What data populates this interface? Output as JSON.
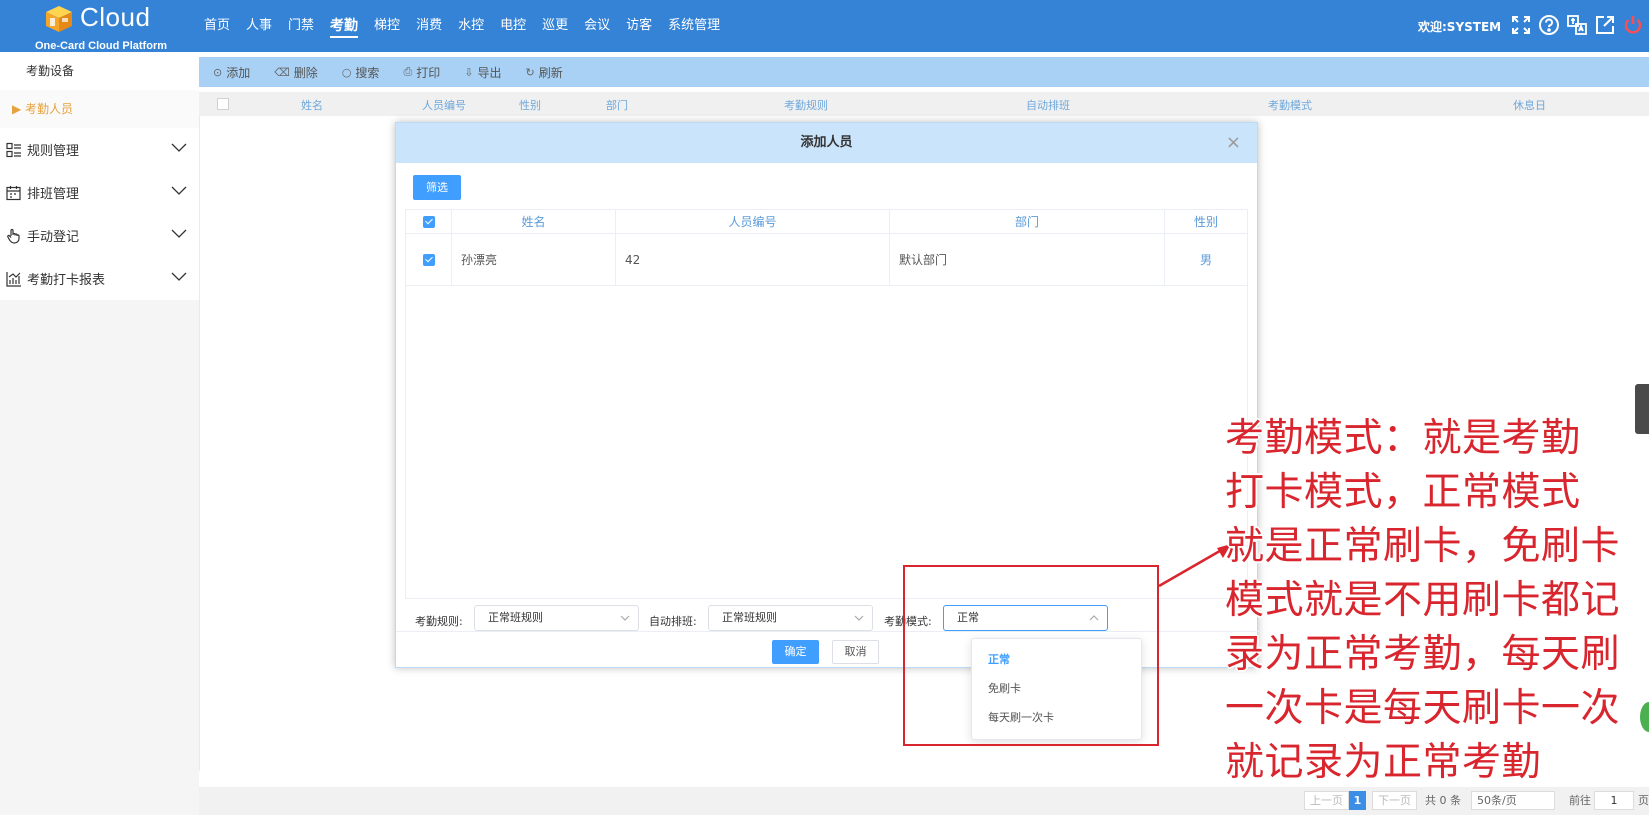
{
  "header": {
    "logo_text": "Cloud",
    "logo_subtitle": "One-Card Cloud Platform",
    "nav": [
      "首页",
      "人事",
      "门禁",
      "考勤",
      "梯控",
      "消费",
      "水控",
      "电控",
      "巡更",
      "会议",
      "访客",
      "系统管理"
    ],
    "active_nav": "考勤",
    "welcome": "欢迎:SYSTEM",
    "icons": [
      "fullscreen-icon",
      "help-icon",
      "translate-icon",
      "external-link-icon",
      "power-icon"
    ]
  },
  "sidebar": {
    "sub_items": [
      {
        "label": "考勤设备"
      },
      {
        "label": "▶ 考勤人员"
      }
    ],
    "groups": [
      {
        "label": "规则管理",
        "icon": "rules-icon"
      },
      {
        "label": "排班管理",
        "icon": "schedule-icon"
      },
      {
        "label": "手动登记",
        "icon": "hand-icon"
      },
      {
        "label": "考勤打卡报表",
        "icon": "report-icon"
      }
    ]
  },
  "toolbar": {
    "buttons": [
      {
        "label": "添加",
        "icon": "⊙"
      },
      {
        "label": "删除",
        "icon": "🗑"
      },
      {
        "label": "搜索",
        "icon": "○"
      },
      {
        "label": "打印",
        "icon": "⎙"
      },
      {
        "label": "导出",
        "icon": "⇩"
      },
      {
        "label": "刷新",
        "icon": "↻"
      }
    ]
  },
  "main_table": {
    "columns": [
      "姓名",
      "人员编号",
      "性别",
      "部门",
      "考勤规则",
      "自动排班",
      "考勤模式",
      "休息日"
    ]
  },
  "pagination": {
    "prev": "上一页",
    "current": "1",
    "next": "下一页",
    "total": "共 0 条",
    "page_size": "50条/页",
    "goto_label": "前往",
    "goto_value": "1",
    "page_suffix": "页"
  },
  "modal": {
    "title": "添加人员",
    "close": "×",
    "filter_button": "筛选",
    "columns": [
      "姓名",
      "人员编号",
      "部门",
      "性别"
    ],
    "rows": [
      {
        "name": "孙漂亮",
        "id": "42",
        "dept": "默认部门",
        "gender": "男"
      }
    ],
    "form": {
      "rule_label": "考勤规则:",
      "rule_value": "正常班规则",
      "shift_label": "自动排班:",
      "shift_value": "正常班规则",
      "mode_label": "考勤模式:",
      "mode_value": "正常"
    },
    "ok": "确定",
    "cancel": "取消"
  },
  "mode_dropdown": {
    "options": [
      "正常",
      "免刷卡",
      "每天刷一次卡"
    ],
    "selected": "正常"
  },
  "annotation": {
    "text": "考勤模式：就是考勤\n打卡模式，正常模式\n就是正常刷卡，免刷卡\n模式就是不用刷卡都记\n录为正常考勤，每天刷\n一次卡是每天刷卡一次\n就记录为正常考勤",
    "color": "#d9262e"
  },
  "colors": {
    "header": "#3583d7",
    "toolbar": "#a9d1f5",
    "primary": "#409eff",
    "active_side": "#e6a23c"
  }
}
